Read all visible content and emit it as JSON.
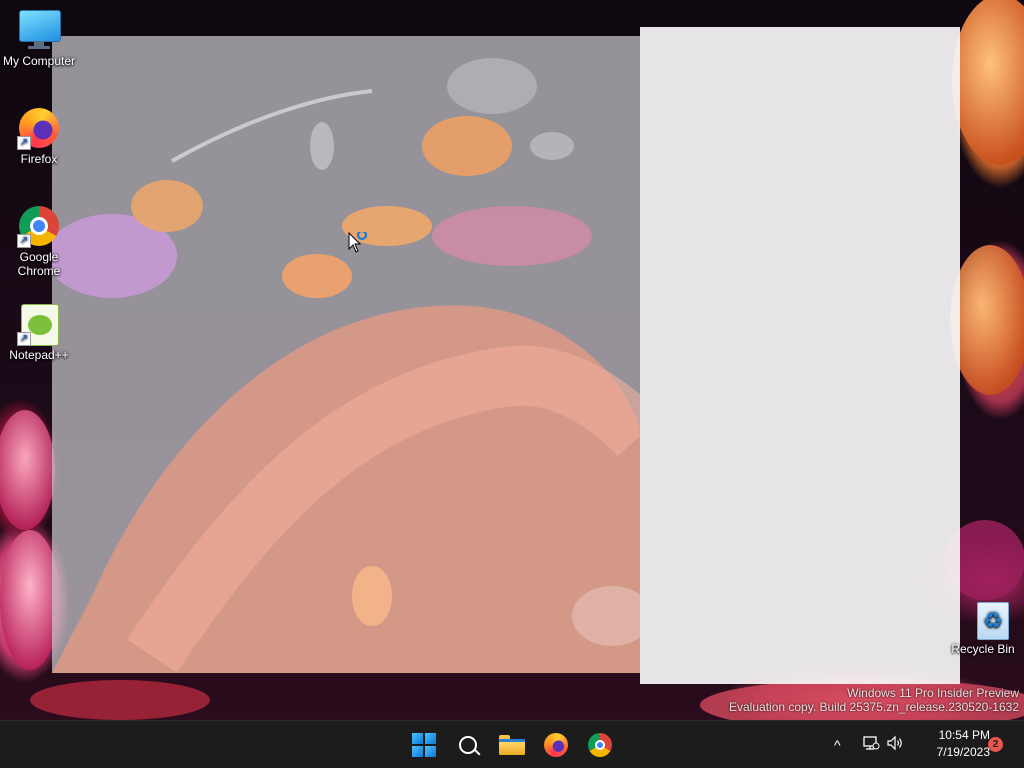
{
  "desktop": {
    "icons": [
      {
        "label": "My Computer",
        "icon": "computer-icon"
      },
      {
        "label": "Firefox",
        "icon": "firefox-icon"
      },
      {
        "label": "Google Chrome",
        "icon": "chrome-icon"
      },
      {
        "label": "Notepad++",
        "icon": "notepadpp-icon"
      },
      {
        "label": "Recycle Bin",
        "icon": "recycle-bin-icon"
      }
    ],
    "watermark": {
      "line1": "Windows 11 Pro Insider Preview",
      "line2": "Evaluation copy. Build 25375.zn_release.230520-1632"
    }
  },
  "taskbar": {
    "pinned": [
      {
        "name": "Start",
        "icon": "windows-start-icon"
      },
      {
        "name": "Search",
        "icon": "search-icon"
      },
      {
        "name": "File Explorer",
        "icon": "folder-icon"
      },
      {
        "name": "Firefox",
        "icon": "firefox-icon"
      },
      {
        "name": "Google Chrome",
        "icon": "chrome-icon"
      }
    ],
    "tray": {
      "chevron": "^",
      "time": "10:54 PM",
      "date": "7/19/2023",
      "notification_count": "2"
    }
  },
  "colors": {
    "taskbar_bg": "#1c1c1c",
    "accent": "#0a78d4",
    "badge": "#e8574c"
  }
}
